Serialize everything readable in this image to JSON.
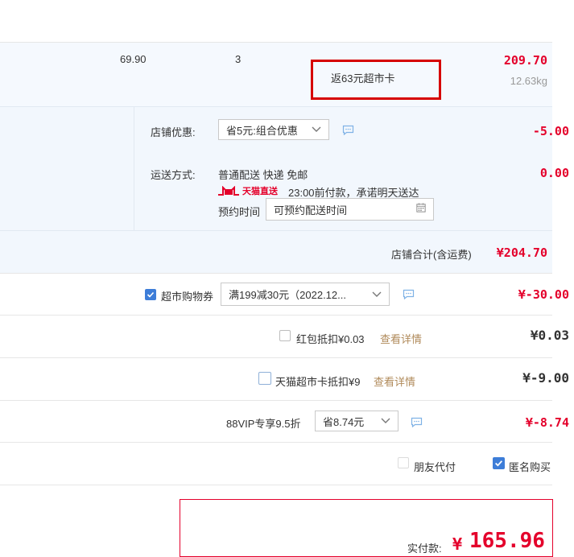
{
  "item": {
    "unit_price": "69.90",
    "quantity": "3",
    "promo_tag": "返63元超市卡",
    "subtotal": "209.70",
    "weight": "12.63kg"
  },
  "shop": {
    "discount_label": "店铺优惠:",
    "discount_selected": "省5元:组合优惠",
    "discount_amount": "-5.00",
    "shipping_label": "运送方式:",
    "shipping_method": "普通配送 快递 免邮",
    "tmall_badge": "天猫直送",
    "shipping_promise": "23:00前付款，承诺明天送达",
    "shipping_amount": "0.00",
    "schedule_label": "预约时间",
    "schedule_placeholder": "可预约配送时间",
    "total_label": "店铺合计(含运费)",
    "total_amount": "¥204.70"
  },
  "coupons": {
    "supermarket_label": "超市购物券",
    "supermarket_selected": "满199减30元（2022.12...",
    "supermarket_amount": "¥-30.00",
    "redpacket_label": "红包抵扣¥0.03",
    "redpacket_link": "查看详情",
    "redpacket_amount": "¥0.03",
    "tmallcard_label": "天猫超市卡抵扣¥9",
    "tmallcard_link": "查看详情",
    "tmallcard_amount": "¥-9.00",
    "vip_label": "88VIP专享9.5折",
    "vip_selected": "省8.74元",
    "vip_amount": "¥-8.74"
  },
  "options": {
    "friend_pay": "朋友代付",
    "anonymous": "匿名购买"
  },
  "footer": {
    "pay_label": "实付款:",
    "currency": "¥",
    "pay_amount": "165.96"
  },
  "colors": {
    "price_red": "#e4002b",
    "highlight_box": "#d60000",
    "band_bg": "#f2f7fd",
    "checkbox_blue": "#3d7dd8"
  }
}
